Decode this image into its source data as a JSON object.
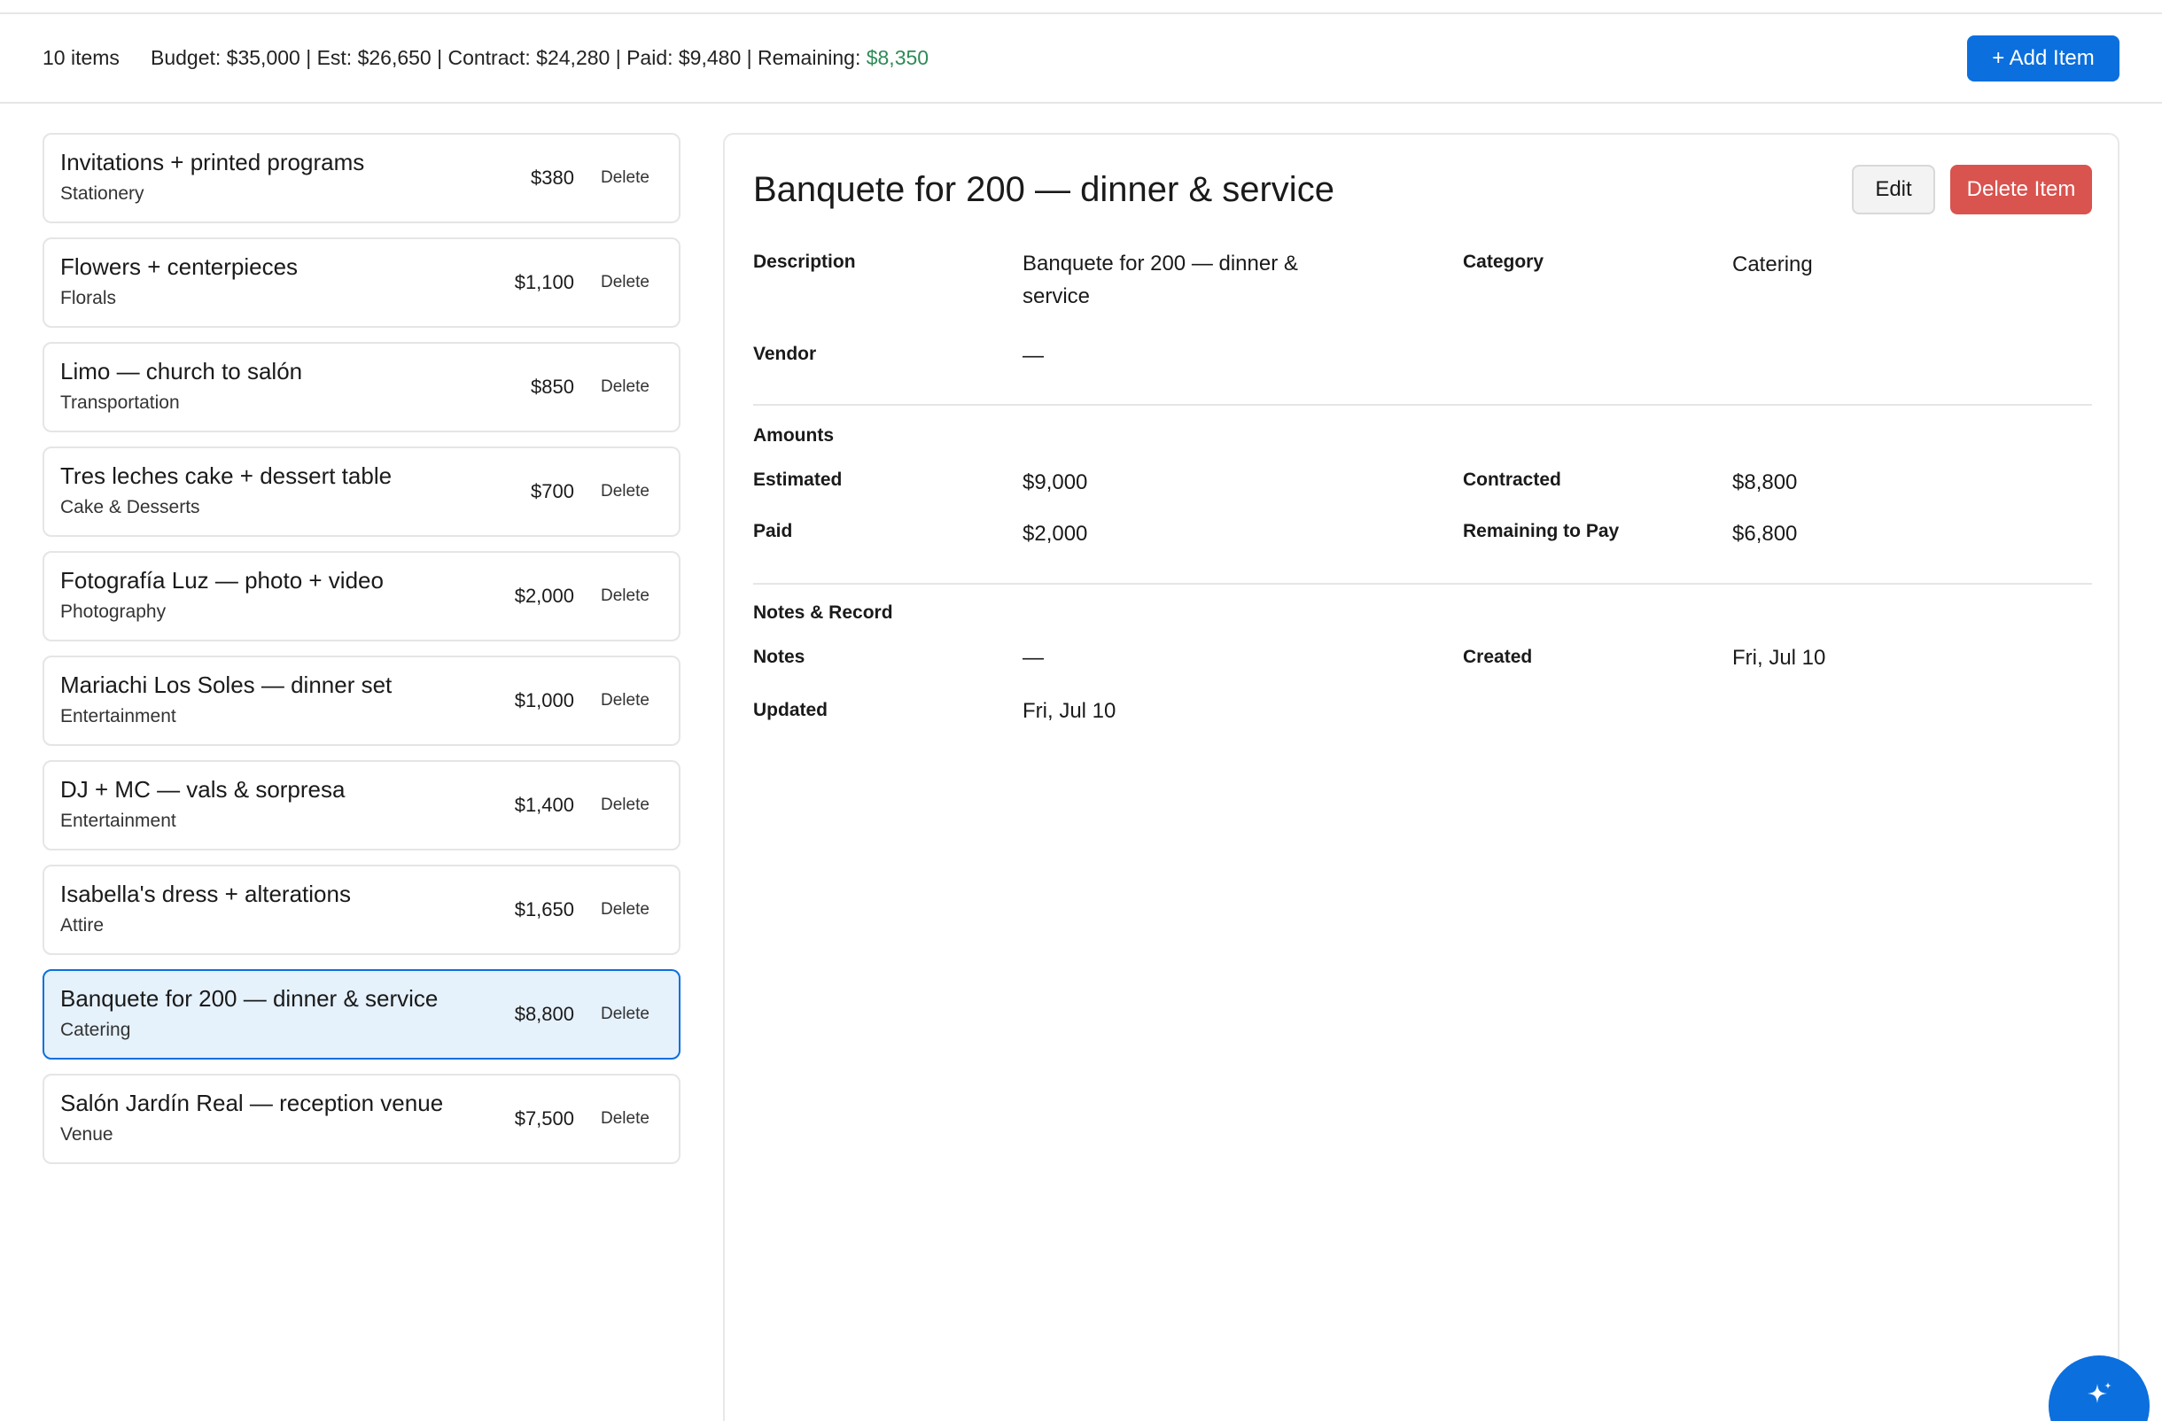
{
  "summary": {
    "item_count": "10 items",
    "budget_text": "Budget: $35,000 | Est: $26,650 | Contract: $24,280 | Paid: $9,480 | Remaining: ",
    "remaining_value": "$8,350",
    "add_button": "+ Add Item"
  },
  "items": [
    {
      "name": "Invitations + printed programs",
      "category": "Stationery",
      "amount": "$380",
      "delete": "Delete"
    },
    {
      "name": "Flowers + centerpieces",
      "category": "Florals",
      "amount": "$1,100",
      "delete": "Delete"
    },
    {
      "name": "Limo — church to salón",
      "category": "Transportation",
      "amount": "$850",
      "delete": "Delete"
    },
    {
      "name": "Tres leches cake + dessert table",
      "category": "Cake & Desserts",
      "amount": "$700",
      "delete": "Delete"
    },
    {
      "name": "Fotografía Luz — photo + video",
      "category": "Photography",
      "amount": "$2,000",
      "delete": "Delete"
    },
    {
      "name": "Mariachi Los Soles — dinner set",
      "category": "Entertainment",
      "amount": "$1,000",
      "delete": "Delete"
    },
    {
      "name": "DJ + MC — vals & sorpresa",
      "category": "Entertainment",
      "amount": "$1,400",
      "delete": "Delete"
    },
    {
      "name": "Isabella's dress + alterations",
      "category": "Attire",
      "amount": "$1,650",
      "delete": "Delete"
    },
    {
      "name": "Banquete for 200 — dinner & service",
      "category": "Catering",
      "amount": "$8,800",
      "delete": "Delete",
      "selected": true
    },
    {
      "name": "Salón Jardín Real — reception venue",
      "category": "Venue",
      "amount": "$7,500",
      "delete": "Delete"
    }
  ],
  "detail": {
    "title": "Banquete for 200 — dinner & service",
    "edit_button": "Edit",
    "delete_button": "Delete Item",
    "description_label": "Description",
    "description_value": "Banquete for 200 — dinner & service",
    "category_label": "Category",
    "category_value": "Catering",
    "vendor_label": "Vendor",
    "vendor_value": "—",
    "amounts_heading": "Amounts",
    "estimated_label": "Estimated",
    "estimated_value": "$9,000",
    "contracted_label": "Contracted",
    "contracted_value": "$8,800",
    "paid_label": "Paid",
    "paid_value": "$2,000",
    "remaining_label": "Remaining to Pay",
    "remaining_value": "$6,800",
    "notes_heading": "Notes & Record",
    "notes_label": "Notes",
    "notes_value": "—",
    "created_label": "Created",
    "created_value": "Fri, Jul 10",
    "updated_label": "Updated",
    "updated_value": "Fri, Jul 10"
  },
  "colors": {
    "accent": "#0b6fde",
    "danger": "#d9534f",
    "remaining_green": "#2e8b57",
    "selected_bg": "#e5f1fb"
  },
  "icons": {
    "fab": "sparkle-icon"
  }
}
